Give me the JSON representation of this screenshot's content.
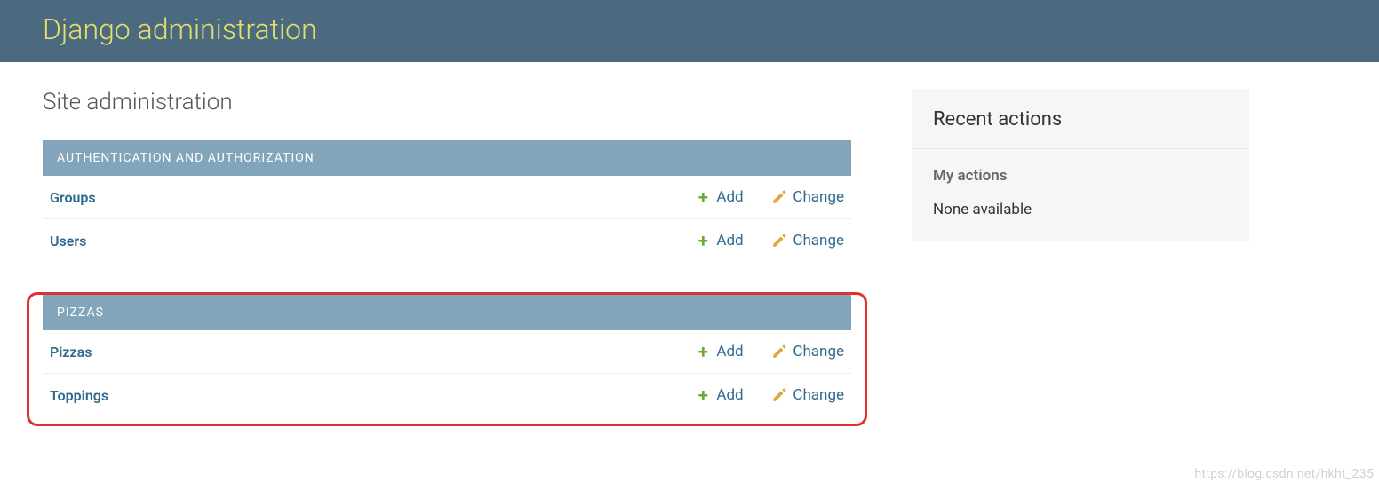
{
  "branding": {
    "title": "Django administration"
  },
  "page": {
    "title": "Site administration"
  },
  "apps": [
    {
      "name": "AUTHENTICATION AND AUTHORIZATION",
      "highlighted": false,
      "models": [
        {
          "name": "Groups",
          "add_label": "Add",
          "change_label": "Change"
        },
        {
          "name": "Users",
          "add_label": "Add",
          "change_label": "Change"
        }
      ]
    },
    {
      "name": "PIZZAS",
      "highlighted": true,
      "models": [
        {
          "name": "Pizzas",
          "add_label": "Add",
          "change_label": "Change"
        },
        {
          "name": "Toppings",
          "add_label": "Add",
          "change_label": "Change"
        }
      ]
    }
  ],
  "sidebar": {
    "recent_title": "Recent actions",
    "my_actions_title": "My actions",
    "empty_text": "None available"
  },
  "watermark": "https://blog.csdn.net/hkht_235"
}
